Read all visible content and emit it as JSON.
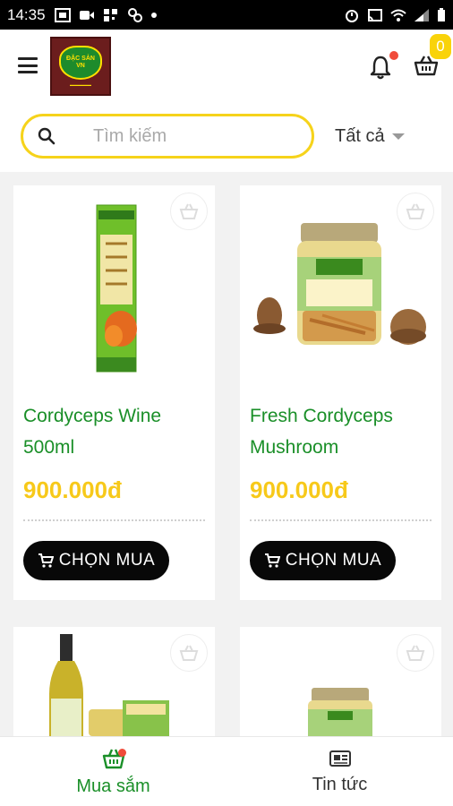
{
  "status_bar": {
    "time": "14:35"
  },
  "header": {
    "cart_count": "0"
  },
  "search": {
    "placeholder": "Tìm kiếm",
    "filter_label": "Tất cả"
  },
  "products": [
    {
      "name": "Cordyceps Wine 500ml",
      "price": "900.000đ",
      "buy_label": "CHỌN MUA"
    },
    {
      "name": "Fresh Cordyceps Mushroom",
      "price": "900.000đ",
      "buy_label": "CHỌN MUA"
    }
  ],
  "bottom_nav": [
    {
      "label": "Mua sắm",
      "icon": "basket-icon",
      "active": true
    },
    {
      "label": "Tin tức",
      "icon": "news-icon",
      "active": false
    }
  ],
  "colors": {
    "accent": "#f6d31b",
    "brand_green": "#1a8f28",
    "price": "#f7c91a",
    "notification": "#f04b3a"
  }
}
